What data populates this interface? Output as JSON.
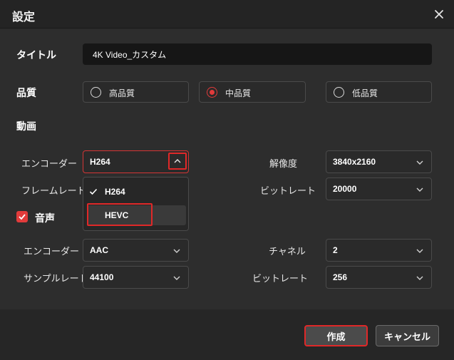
{
  "dialog": {
    "title": "設定"
  },
  "title_field": {
    "label": "タイトル",
    "value": "4K Video_カスタム"
  },
  "quality": {
    "label": "品質",
    "options": [
      {
        "label": "高品質",
        "selected": false
      },
      {
        "label": "中品質",
        "selected": true
      },
      {
        "label": "低品質",
        "selected": false
      }
    ]
  },
  "video": {
    "section_label": "動画",
    "encoder_label": "エンコーダー",
    "encoder_value": "H264",
    "framerate_label": "フレームレート",
    "resolution_label": "解像度",
    "resolution_value": "3840x2160",
    "bitrate_label": "ビットレート",
    "bitrate_value": "20000",
    "encoder_options": [
      {
        "label": "H264",
        "checked": true
      },
      {
        "label": "HEVC",
        "checked": false
      }
    ]
  },
  "audio": {
    "section_label": "音声",
    "enabled": true,
    "encoder_label": "エンコーダー",
    "encoder_value": "AAC",
    "samplerate_label": "サンプルレート",
    "samplerate_value": "44100",
    "channel_label": "チャネル",
    "channel_value": "2",
    "bitrate_label": "ビットレート",
    "bitrate_value": "256"
  },
  "footer": {
    "create_label": "作成",
    "cancel_label": "キャンセル"
  },
  "colors": {
    "accent": "#e23b3b",
    "highlight": "#e02828",
    "background": "#2d2d2d"
  }
}
